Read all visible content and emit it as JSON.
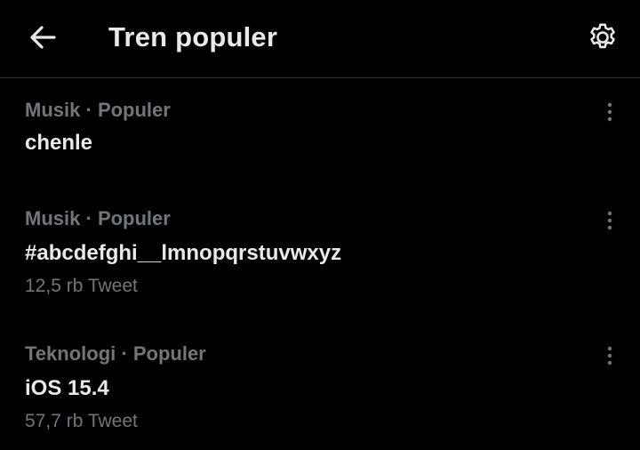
{
  "header": {
    "title": "Tren populer",
    "back_icon": "arrow-left-icon",
    "settings_icon": "gear-icon"
  },
  "trends": [
    {
      "category": "Musik",
      "separator": "·",
      "status": "Populer",
      "name": "chenle",
      "count": ""
    },
    {
      "category": "Musik",
      "separator": "·",
      "status": "Populer",
      "name": "#abcdefghi__lmnopqrstuvwxyz",
      "count": "12,5 rb Tweet"
    },
    {
      "category": "Teknologi",
      "separator": "·",
      "status": "Populer",
      "name": "iOS 15.4",
      "count": "57,7 rb Tweet"
    }
  ],
  "colors": {
    "background": "#000000",
    "primary_text": "#e7e9ea",
    "secondary_text": "#71767b",
    "divider": "#2f3336"
  }
}
